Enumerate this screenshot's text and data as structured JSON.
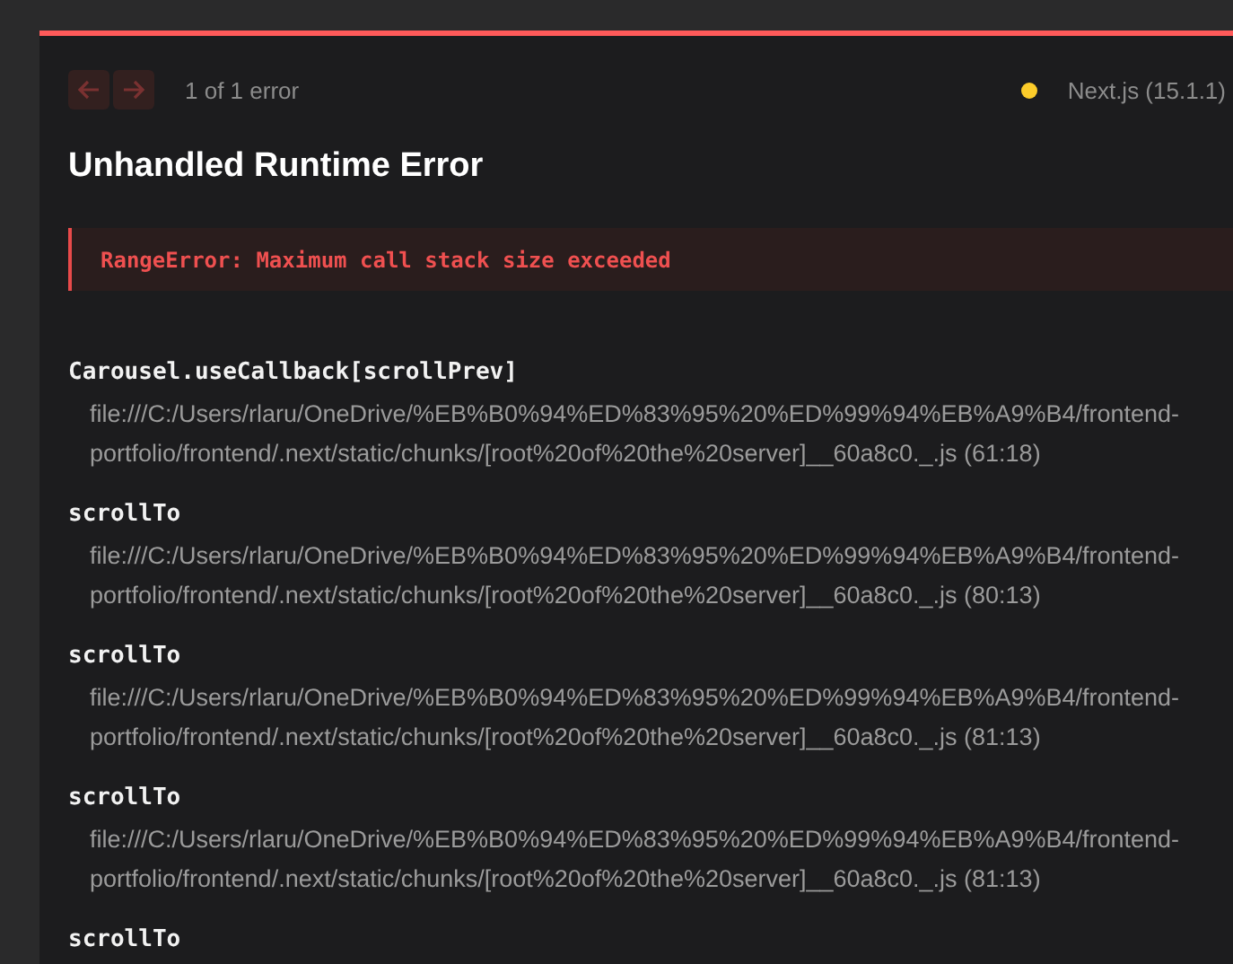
{
  "header": {
    "pagination": "1 of 1 error",
    "version": "Next.js (15.1.1)"
  },
  "title": "Unhandled Runtime Error",
  "error_message": "RangeError: Maximum call stack size exceeded",
  "stack_frames": [
    {
      "function": "Carousel.useCallback[scrollPrev]",
      "location": "file:///C:/Users/rlaru/OneDrive/%EB%B0%94%ED%83%95%20%ED%99%94%EB%A9%B4/frontend-portfolio/frontend/.next/static/chunks/[root%20of%20the%20server]__60a8c0._.js (61:18)"
    },
    {
      "function": "scrollTo",
      "location": "file:///C:/Users/rlaru/OneDrive/%EB%B0%94%ED%83%95%20%ED%99%94%EB%A9%B4/frontend-portfolio/frontend/.next/static/chunks/[root%20of%20the%20server]__60a8c0._.js (80:13)"
    },
    {
      "function": "scrollTo",
      "location": "file:///C:/Users/rlaru/OneDrive/%EB%B0%94%ED%83%95%20%ED%99%94%EB%A9%B4/frontend-portfolio/frontend/.next/static/chunks/[root%20of%20the%20server]__60a8c0._.js (81:13)"
    },
    {
      "function": "scrollTo",
      "location": "file:///C:/Users/rlaru/OneDrive/%EB%B0%94%ED%83%95%20%ED%99%94%EB%A9%B4/frontend-portfolio/frontend/.next/static/chunks/[root%20of%20the%20server]__60a8c0._.js (81:13)"
    },
    {
      "function": "scrollTo"
    }
  ]
}
